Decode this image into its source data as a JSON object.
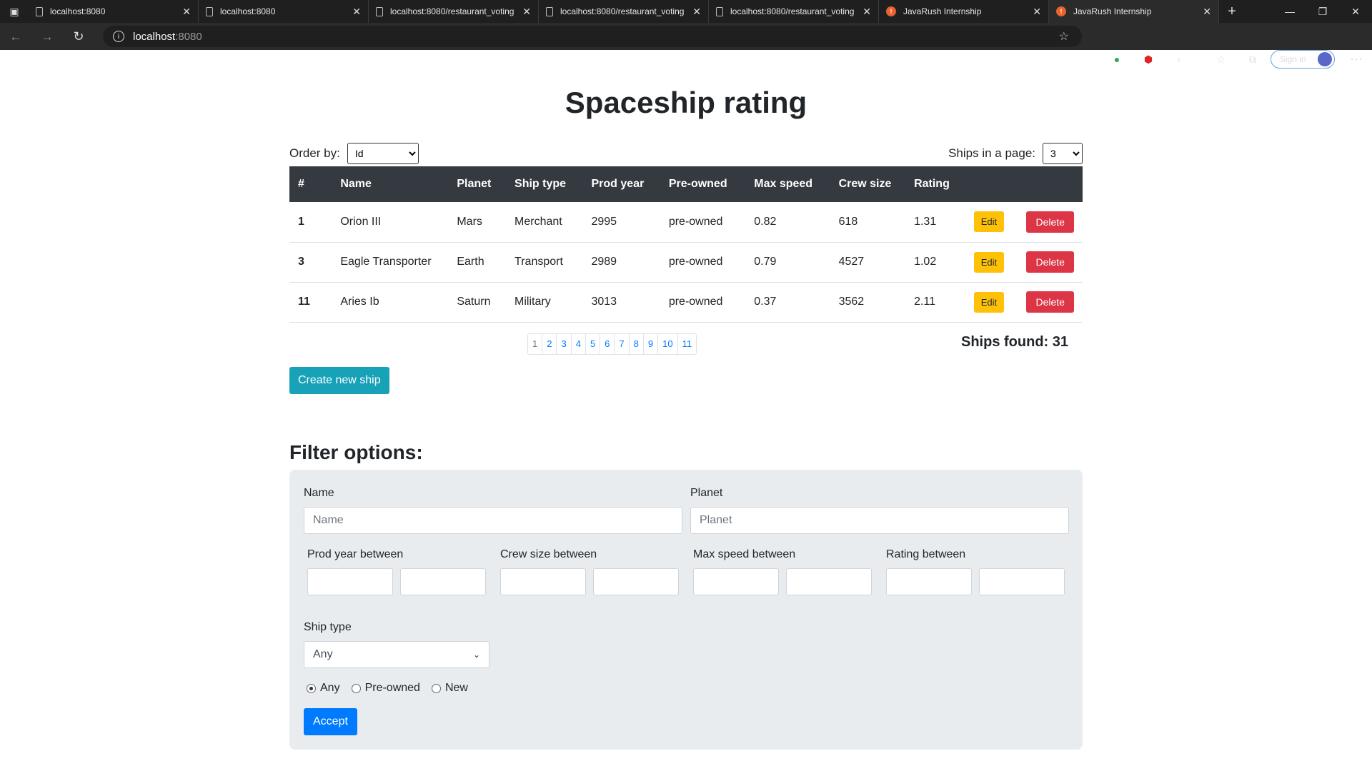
{
  "browser": {
    "tabs": [
      {
        "title": "localhost:8080",
        "favicon": "doc",
        "active": false
      },
      {
        "title": "localhost:8080",
        "favicon": "doc",
        "active": false
      },
      {
        "title": "localhost:8080/restaurant_voting",
        "favicon": "doc",
        "active": false
      },
      {
        "title": "localhost:8080/restaurant_voting",
        "favicon": "doc",
        "active": false
      },
      {
        "title": "localhost:8080/restaurant_voting",
        "favicon": "doc",
        "active": false
      },
      {
        "title": "JavaRush Internship",
        "favicon": "javarush",
        "active": false
      },
      {
        "title": "JavaRush Internship",
        "favicon": "javarush",
        "active": true
      }
    ],
    "url_host": "localhost",
    "url_port": ":8080",
    "signin_label": "Sign in"
  },
  "page": {
    "title": "Spaceship rating",
    "order_label": "Order by:",
    "order_value": "Id",
    "perpage_label": "Ships in a page:",
    "perpage_value": "3",
    "table": {
      "headers": [
        "#",
        "Name",
        "Planet",
        "Ship type",
        "Prod year",
        "Pre-owned",
        "Max speed",
        "Crew size",
        "Rating"
      ],
      "rows": [
        {
          "id": "1",
          "name": "Orion III",
          "planet": "Mars",
          "type": "Merchant",
          "year": "2995",
          "used": "pre-owned",
          "speed": "0.82",
          "crew": "618",
          "rating": "1.31"
        },
        {
          "id": "3",
          "name": "Eagle Transporter",
          "planet": "Earth",
          "type": "Transport",
          "year": "2989",
          "used": "pre-owned",
          "speed": "0.79",
          "crew": "4527",
          "rating": "1.02"
        },
        {
          "id": "11",
          "name": "Aries Ib",
          "planet": "Saturn",
          "type": "Military",
          "year": "3013",
          "used": "pre-owned",
          "speed": "0.37",
          "crew": "3562",
          "rating": "2.11"
        }
      ],
      "edit_label": "Edit",
      "delete_label": "Delete"
    },
    "pages": [
      "1",
      "2",
      "3",
      "4",
      "5",
      "6",
      "7",
      "8",
      "9",
      "10",
      "11"
    ],
    "ships_found": "Ships found: 31",
    "create_label": "Create new ship",
    "filter": {
      "heading": "Filter options:",
      "name_label": "Name",
      "name_placeholder": "Name",
      "planet_label": "Planet",
      "planet_placeholder": "Planet",
      "prod_year_label": "Prod year between",
      "crew_size_label": "Crew size between",
      "max_speed_label": "Max speed between",
      "rating_label": "Rating between",
      "ship_type_label": "Ship type",
      "ship_type_value": "Any",
      "radio_any": "Any",
      "radio_preowned": "Pre-owned",
      "radio_new": "New",
      "accept_label": "Accept"
    }
  }
}
